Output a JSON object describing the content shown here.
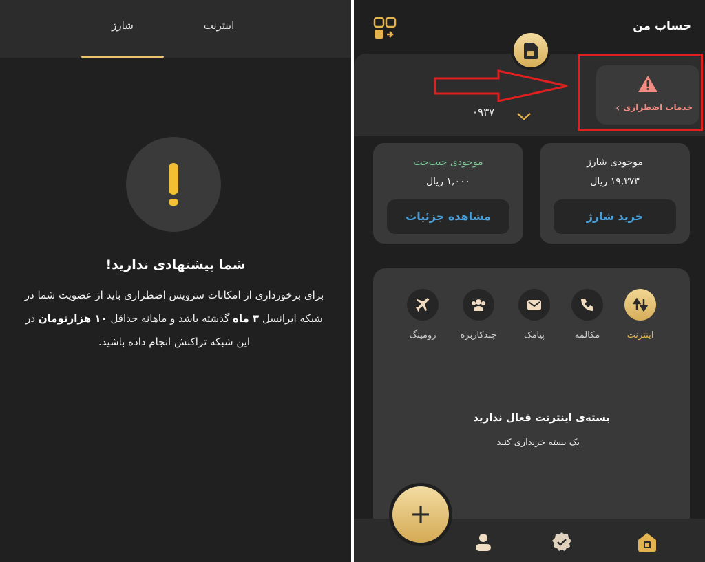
{
  "left": {
    "tabs": [
      {
        "label": "اینترنت"
      },
      {
        "label": "شارژ"
      }
    ],
    "no_offer": {
      "title": "شما پیشنهادی ندارید!",
      "body_1": "برای برخورداری از امکانات سرویس اضطراری باید از عضویت شما در شبکه ایرانسل ",
      "body_bold_1": "۳ ماه",
      "body_2": " گذشته باشد و ماهانه حداقل ",
      "body_bold_2": "۱۰ هزارتومان",
      "body_3": " در این شبکه تراکنش انجام داده باشید."
    }
  },
  "right": {
    "header": {
      "title": "حساب من"
    },
    "phone_number": "۰۹۳۷",
    "emergency": {
      "label": "خدمات اضطراری"
    },
    "charge_card": {
      "title": "موجودی شارژ",
      "amount": "۱۹,۳۷۳ ریال",
      "button": "خرید شارژ"
    },
    "wallet_card": {
      "title": "موجودی جیب‌جت",
      "amount": "۱,۰۰۰ ریال",
      "button": "مشاهده جزئیات"
    },
    "categories": [
      {
        "label": "اینترنت",
        "icon": "internet-icon",
        "active": true
      },
      {
        "label": "مکالمه",
        "icon": "phone-icon",
        "active": false
      },
      {
        "label": "پیامک",
        "icon": "sms-icon",
        "active": false
      },
      {
        "label": "چندکاربره",
        "icon": "multi-user-icon",
        "active": false
      },
      {
        "label": "رومینگ",
        "icon": "plane-icon",
        "active": false
      }
    ],
    "empty": {
      "title": "بسته‌ی اینترنت فعال ندارید",
      "subtitle": "یک بسته خریداری کنید"
    },
    "fab": {
      "label": "+"
    },
    "bottom_nav": [
      {
        "icon": "profile-icon"
      },
      {
        "icon": "verified-badge-icon"
      },
      {
        "icon": "home-icon"
      }
    ]
  },
  "colors": {
    "accent": "#e3b34f",
    "link": "#4a9fd8",
    "alert": "#f28b82",
    "highlight": "#e02020"
  }
}
